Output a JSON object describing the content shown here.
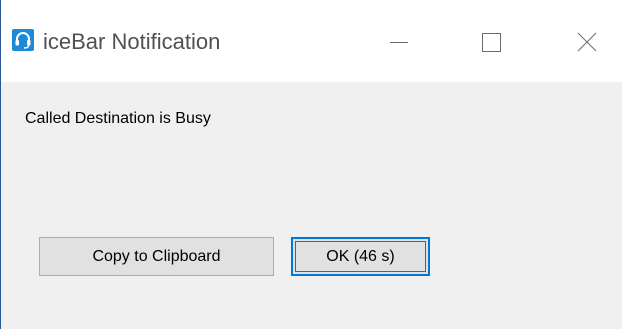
{
  "window": {
    "title": "iceBar Notification",
    "app_icon": "headset-icon",
    "controls": {
      "minimize": "minimize-icon",
      "maximize": "maximize-icon",
      "close": "close-icon"
    }
  },
  "dialog": {
    "message": "Called Destination is Busy",
    "copy_button_label": "Copy to Clipboard",
    "ok_button_label": "OK (46 s)"
  },
  "colors": {
    "accent": "#0078d7",
    "app_icon": "#1c8ad6",
    "window_border": "#2b579a",
    "background": "#f0f0f0"
  }
}
